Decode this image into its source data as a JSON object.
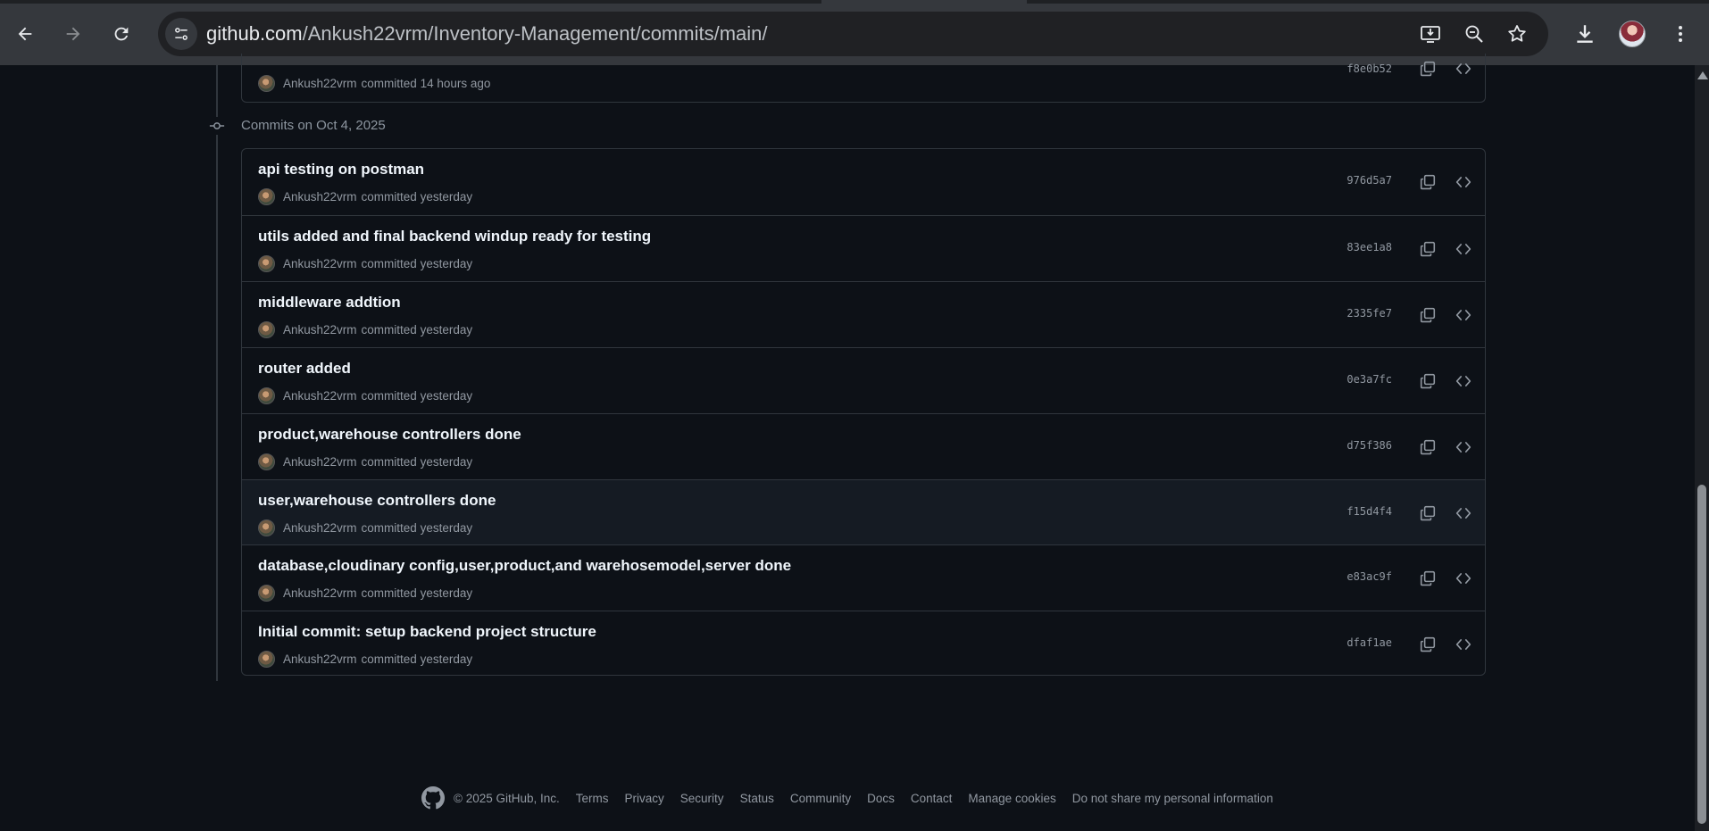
{
  "browser": {
    "url_host": "github.com",
    "url_path": "/Ankush22vrm/Inventory-Management/commits/main/"
  },
  "top_commit": {
    "author": "Ankush22vrm",
    "action": "committed",
    "time": "14 hours ago",
    "sha": "f8e0b52"
  },
  "group": {
    "heading": "Commits on Oct 4, 2025"
  },
  "commits": [
    {
      "title": "api testing on postman",
      "author": "Ankush22vrm",
      "action": "committed",
      "time": "yesterday",
      "sha": "976d5a7"
    },
    {
      "title": "utils added and final backend windup ready for testing",
      "author": "Ankush22vrm",
      "action": "committed",
      "time": "yesterday",
      "sha": "83ee1a8"
    },
    {
      "title": "middleware addtion",
      "author": "Ankush22vrm",
      "action": "committed",
      "time": "yesterday",
      "sha": "2335fe7"
    },
    {
      "title": "router added",
      "author": "Ankush22vrm",
      "action": "committed",
      "time": "yesterday",
      "sha": "0e3a7fc"
    },
    {
      "title": "product,warehouse controllers done",
      "author": "Ankush22vrm",
      "action": "committed",
      "time": "yesterday",
      "sha": "d75f386"
    },
    {
      "title": "user,warehouse controllers done",
      "author": "Ankush22vrm",
      "action": "committed",
      "time": "yesterday",
      "sha": "f15d4f4"
    },
    {
      "title": "database,cloudinary config,user,product,and warehosemodel,server done",
      "author": "Ankush22vrm",
      "action": "committed",
      "time": "yesterday",
      "sha": "e83ac9f"
    },
    {
      "title": "Initial commit: setup backend project structure",
      "author": "Ankush22vrm",
      "action": "committed",
      "time": "yesterday",
      "sha": "dfaf1ae"
    }
  ],
  "footer": {
    "copyright": "© 2025 GitHub, Inc.",
    "links": [
      "Terms",
      "Privacy",
      "Security",
      "Status",
      "Community",
      "Docs",
      "Contact",
      "Manage cookies",
      "Do not share my personal information"
    ]
  },
  "colors": {
    "page_bg": "#0d1117",
    "border": "#30363d",
    "title_text": "#f0f6fc",
    "muted_text": "#9198a1",
    "chrome_bg": "#35383d",
    "omnibox_bg": "#202124"
  },
  "icons": [
    "back-arrow-icon",
    "forward-arrow-icon",
    "reload-icon",
    "site-info-icon",
    "install-app-icon",
    "zoom-icon",
    "star-icon",
    "download-icon",
    "profile-avatar",
    "kebab-menu-icon",
    "commit-node-icon",
    "copy-icon",
    "code-icon",
    "github-logo-icon"
  ]
}
